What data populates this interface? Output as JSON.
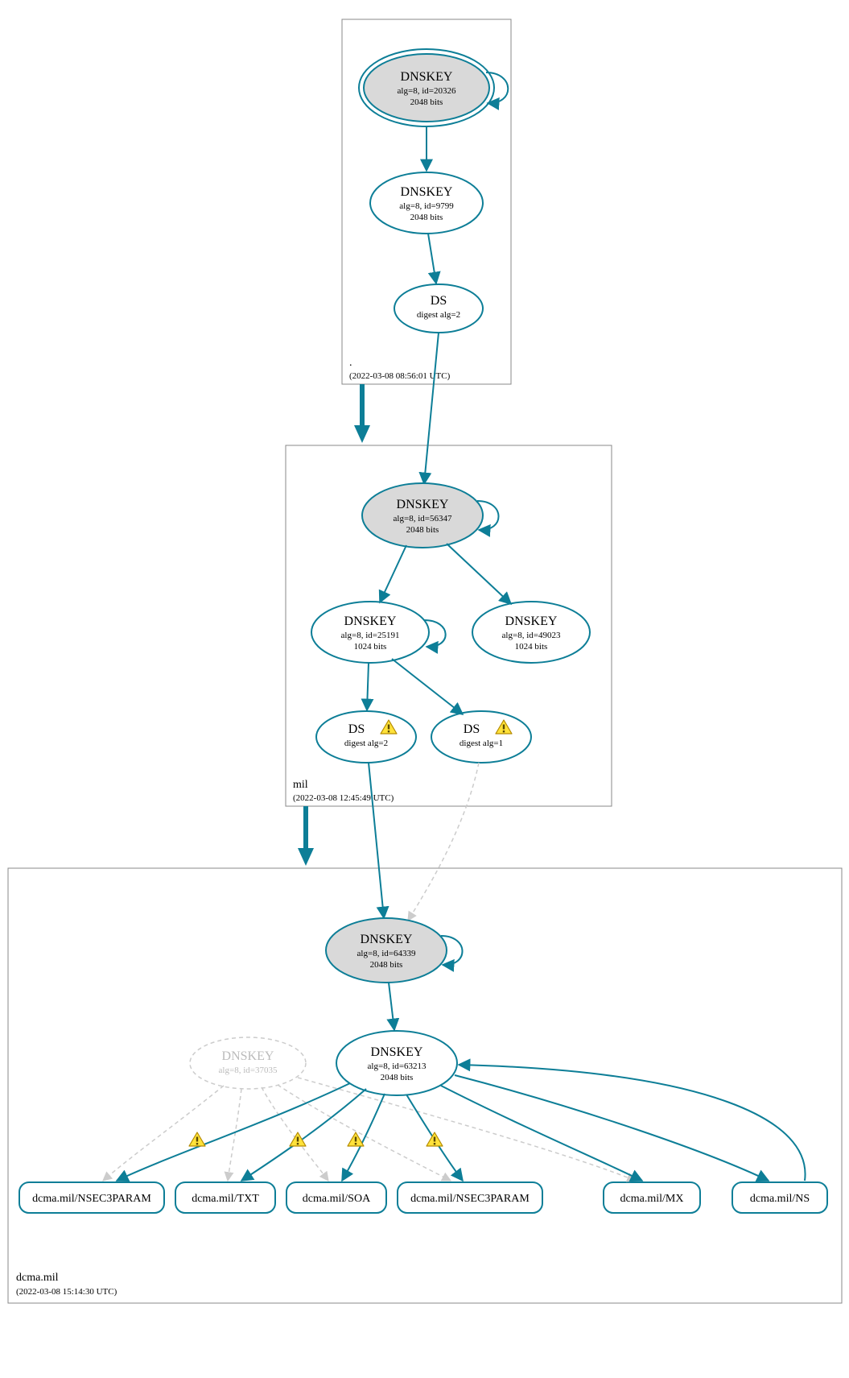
{
  "colors": {
    "accent": "#0d7e97",
    "zone_border": "#888888",
    "node_grey": "#d9d9d9",
    "dashed": "#cccccc",
    "warn_fill": "#ffe23a",
    "warn_stroke": "#b48a00"
  },
  "zones": {
    "root": {
      "label": ".",
      "time": "(2022-03-08 08:56:01 UTC)"
    },
    "mil": {
      "label": "mil",
      "time": "(2022-03-08 12:45:49 UTC)"
    },
    "dcma": {
      "label": "dcma.mil",
      "time": "(2022-03-08 15:14:30 UTC)"
    }
  },
  "nodes": {
    "root_ksk": {
      "title": "DNSKEY",
      "l1": "alg=8, id=20326",
      "l2": "2048 bits"
    },
    "root_zsk": {
      "title": "DNSKEY",
      "l1": "alg=8, id=9799",
      "l2": "2048 bits"
    },
    "root_ds": {
      "title": "DS",
      "l1": "digest alg=2"
    },
    "mil_ksk": {
      "title": "DNSKEY",
      "l1": "alg=8, id=56347",
      "l2": "2048 bits"
    },
    "mil_zsk": {
      "title": "DNSKEY",
      "l1": "alg=8, id=25191",
      "l2": "1024 bits"
    },
    "mil_zsk2": {
      "title": "DNSKEY",
      "l1": "alg=8, id=49023",
      "l2": "1024 bits"
    },
    "mil_ds1": {
      "title": "DS",
      "l1": "digest alg=2"
    },
    "mil_ds2": {
      "title": "DS",
      "l1": "digest alg=1"
    },
    "dcma_ksk": {
      "title": "DNSKEY",
      "l1": "alg=8, id=64339",
      "l2": "2048 bits"
    },
    "dcma_zsk": {
      "title": "DNSKEY",
      "l1": "alg=8, id=63213",
      "l2": "2048 bits"
    },
    "dcma_zsk2": {
      "title": "DNSKEY",
      "l1": "alg=8, id=37035"
    },
    "rr1": {
      "label": "dcma.mil/NSEC3PARAM"
    },
    "rr2": {
      "label": "dcma.mil/TXT"
    },
    "rr3": {
      "label": "dcma.mil/SOA"
    },
    "rr4": {
      "label": "dcma.mil/NSEC3PARAM"
    },
    "rr5": {
      "label": "dcma.mil/MX"
    },
    "rr6": {
      "label": "dcma.mil/NS"
    }
  }
}
